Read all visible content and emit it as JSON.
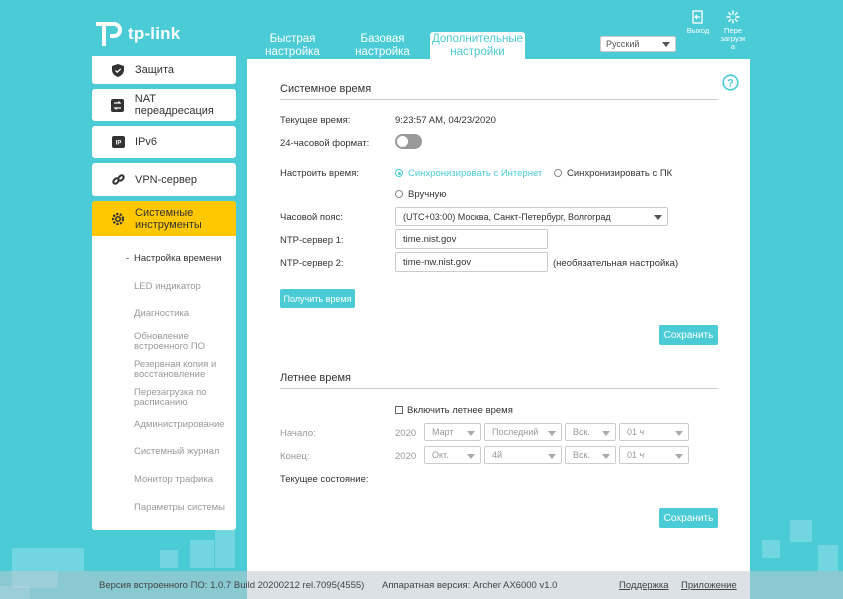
{
  "header": {
    "brand": "tp-link",
    "tabs": [
      {
        "label_line1": "Быстрая",
        "label_line2": "настройка"
      },
      {
        "label_line1": "Базовая",
        "label_line2": "настройка"
      },
      {
        "label_line1": "Дополнительные",
        "label_line2": "настройки"
      }
    ],
    "language": "Русский",
    "logout_label": "Выход",
    "reboot_label_line1": "Пере",
    "reboot_label_line2": "загрузк",
    "reboot_label_line3": "а"
  },
  "sidebar": {
    "items": [
      {
        "label": "Защита",
        "icon": "shield-icon"
      },
      {
        "label": "NAT переадресация",
        "icon": "nat-icon"
      },
      {
        "label": "IPv6",
        "icon": "ipv6-icon"
      },
      {
        "label": "VPN-сервер",
        "icon": "link-icon"
      },
      {
        "label_line1": "Системные",
        "label_line2": "инструменты",
        "icon": "gear-icon"
      }
    ],
    "sub_items": [
      {
        "label": "Настройка времени"
      },
      {
        "label": "LED индикатор"
      },
      {
        "label": "Диагностика"
      },
      {
        "label_line1": "Обновление",
        "label_line2": "встроенного ПО"
      },
      {
        "label_line1": "Резервная копия и",
        "label_line2": "восстановление"
      },
      {
        "label_line1": "Перезагрузка по",
        "label_line2": "расписанию"
      },
      {
        "label": "Администрирование"
      },
      {
        "label": "Системный журнал"
      },
      {
        "label": "Монитор трафика"
      },
      {
        "label": "Параметры системы"
      }
    ]
  },
  "system_time": {
    "title": "Системное время",
    "current_time_label": "Текущее время:",
    "current_time_value": "9:23:57 AM, 04/23/2020",
    "format24_label": "24-часовой формат:",
    "set_time_label": "Настроить время:",
    "opt_internet": "Синхронизировать с Интернет",
    "opt_pc": "Синхронизировать с ПК",
    "opt_manual": "Вручную",
    "timezone_label": "Часовой пояс:",
    "timezone_value": "(UTC+03:00) Москва, Санкт-Петербург, Волгоград",
    "ntp1_label": "NTP-сервер 1:",
    "ntp1_value": "time.nist.gov",
    "ntp2_label": "NTP-сервер 2:",
    "ntp2_value": "time-nw.nist.gov",
    "ntp2_hint": "(необязательная настройка)",
    "get_time_button": "Получить время",
    "save_button": "Сохранить"
  },
  "dst": {
    "title": "Летнее время",
    "enable_label": "Включить летнее время",
    "start_label": "Начало:",
    "end_label": "Конец:",
    "start": {
      "year": "2020",
      "month": "Март",
      "week": "Последний",
      "day": "Вск.",
      "hour": "01 ч"
    },
    "end": {
      "year": "2020",
      "month": "Окт.",
      "week": "4й",
      "day": "Вск.",
      "hour": "01 ч"
    },
    "status_label": "Текущее состояние:",
    "save_button": "Сохранить"
  },
  "footer": {
    "firmware": "Версия встроенного ПО: 1.0.7 Build 20200212 rel.7095(4555)",
    "hardware": "Аппаратная версия: Archer AX6000 v1.0",
    "support_link": "Поддержка",
    "app_link": "Приложение"
  },
  "colors": {
    "accent": "#4acbd6",
    "active_menu": "#ffc800"
  }
}
